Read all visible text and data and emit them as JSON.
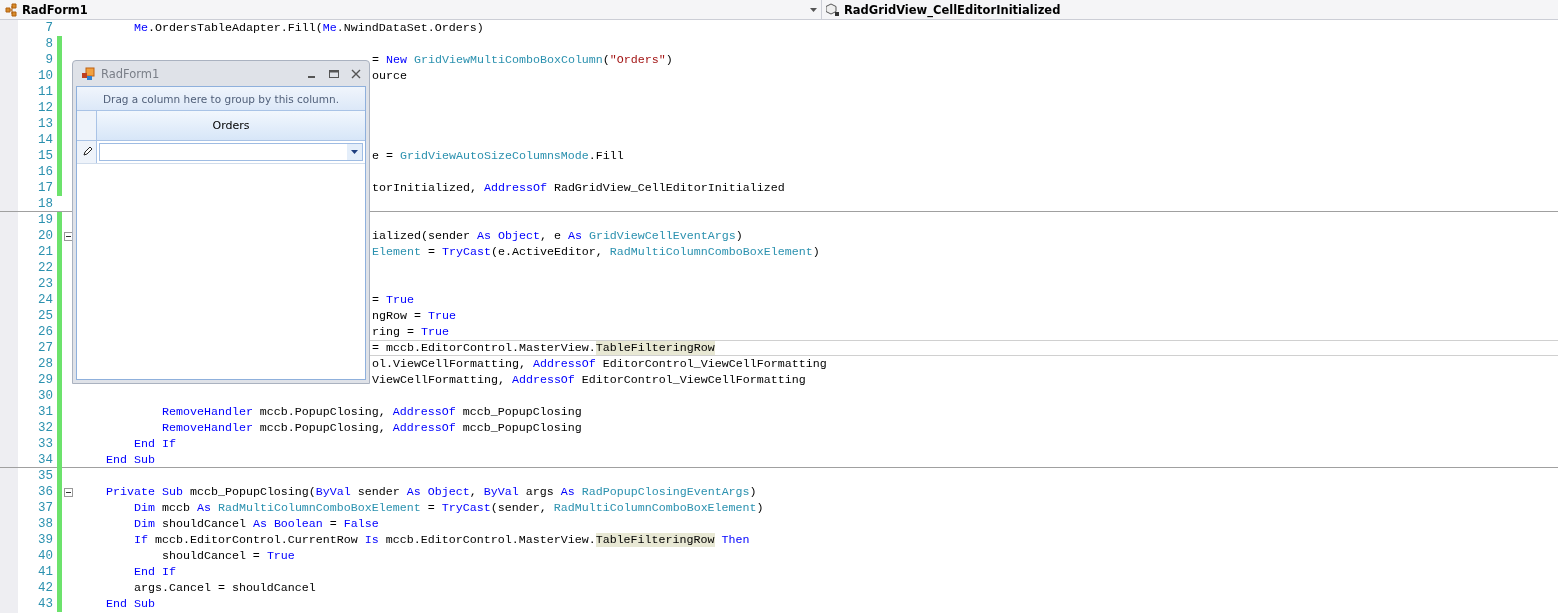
{
  "editor_bar": {
    "class_dropdown": "RadForm1",
    "method_dropdown": "RadGridView_CellEditorInitialized"
  },
  "code_lines": [
    {
      "number": "7",
      "changed": false,
      "collapsible": false,
      "covered": false,
      "current": false,
      "separator": false,
      "tokens": [
        {
          "text": "        Me",
          "kind": "keyword"
        },
        {
          "text": ".OrdersTableAdapter.Fill(",
          "kind": "plain"
        },
        {
          "text": "Me",
          "kind": "keyword"
        },
        {
          "text": ".NwindDataSet.Orders)",
          "kind": "plain"
        }
      ]
    },
    {
      "number": "8",
      "changed": true,
      "collapsible": false,
      "current": false,
      "separator": false
    },
    {
      "number": "9",
      "changed": true,
      "collapsible": false,
      "covered": true,
      "current": false,
      "separator": false,
      "tokens": [
        {
          "text": "= ",
          "kind": "plain"
        },
        {
          "text": "New",
          "kind": "keyword"
        },
        {
          "text": " GridViewMultiComboBoxColumn",
          "kind": "type"
        },
        {
          "text": "(",
          "kind": "plain"
        },
        {
          "text": "\"Orders\"",
          "kind": "string"
        },
        {
          "text": ")",
          "kind": "plain"
        }
      ]
    },
    {
      "number": "10",
      "changed": true,
      "collapsible": false,
      "covered": true,
      "current": false,
      "separator": false,
      "tokens": [
        {
          "text": "ource",
          "kind": "plain"
        }
      ]
    },
    {
      "number": "11",
      "changed": true,
      "collapsible": false,
      "current": false,
      "separator": false
    },
    {
      "number": "12",
      "changed": true,
      "collapsible": false,
      "current": false,
      "separator": false
    },
    {
      "number": "13",
      "changed": true,
      "collapsible": false,
      "current": false,
      "separator": false
    },
    {
      "number": "14",
      "changed": true,
      "collapsible": false,
      "current": false,
      "separator": false
    },
    {
      "number": "15",
      "changed": true,
      "collapsible": false,
      "covered": true,
      "current": false,
      "separator": false,
      "tokens": [
        {
          "text": "e = ",
          "kind": "plain"
        },
        {
          "text": "GridViewAutoSizeColumnsMode",
          "kind": "type"
        },
        {
          "text": ".Fill",
          "kind": "plain"
        }
      ]
    },
    {
      "number": "16",
      "changed": true,
      "collapsible": false,
      "current": false,
      "separator": false
    },
    {
      "number": "17",
      "changed": true,
      "collapsible": false,
      "covered": true,
      "current": false,
      "separator": false,
      "tokens": [
        {
          "text": "torInitialized, ",
          "kind": "plain"
        },
        {
          "text": "AddressOf",
          "kind": "keyword"
        },
        {
          "text": " RadGridView_CellEditorInitialized",
          "kind": "plain"
        }
      ]
    },
    {
      "number": "18",
      "changed": false,
      "collapsible": false,
      "current": false,
      "separator": true
    },
    {
      "number": "19",
      "changed": true,
      "collapsible": false,
      "current": false,
      "separator": false
    },
    {
      "number": "20",
      "changed": true,
      "collapsible": true,
      "covered": true,
      "current": false,
      "separator": false,
      "tokens": [
        {
          "text": "ialized(sender ",
          "kind": "plain"
        },
        {
          "text": "As",
          "kind": "keyword"
        },
        {
          "text": " Object",
          "kind": "keyword"
        },
        {
          "text": ", e ",
          "kind": "plain"
        },
        {
          "text": "As",
          "kind": "keyword"
        },
        {
          "text": " GridViewCellEventArgs",
          "kind": "type"
        },
        {
          "text": ")",
          "kind": "plain"
        }
      ]
    },
    {
      "number": "21",
      "changed": true,
      "collapsible": false,
      "covered": true,
      "current": false,
      "separator": false,
      "tokens": [
        {
          "text": "Element",
          "kind": "type"
        },
        {
          "text": " = ",
          "kind": "plain"
        },
        {
          "text": "TryCast",
          "kind": "keyword"
        },
        {
          "text": "(e.ActiveEditor, ",
          "kind": "plain"
        },
        {
          "text": "RadMultiColumnComboBoxElement",
          "kind": "type"
        },
        {
          "text": ")",
          "kind": "plain"
        }
      ]
    },
    {
      "number": "22",
      "changed": true,
      "collapsible": false,
      "current": false,
      "separator": false
    },
    {
      "number": "23",
      "changed": true,
      "collapsible": false,
      "current": false,
      "separator": false
    },
    {
      "number": "24",
      "changed": true,
      "collapsible": false,
      "covered": true,
      "current": false,
      "separator": false,
      "tokens": [
        {
          "text": "= ",
          "kind": "plain"
        },
        {
          "text": "True",
          "kind": "keyword"
        }
      ]
    },
    {
      "number": "25",
      "changed": true,
      "collapsible": false,
      "covered": true,
      "current": false,
      "separator": false,
      "tokens": [
        {
          "text": "ngRow = ",
          "kind": "plain"
        },
        {
          "text": "True",
          "kind": "keyword"
        }
      ]
    },
    {
      "number": "26",
      "changed": true,
      "collapsible": false,
      "covered": true,
      "current": false,
      "separator": false,
      "tokens": [
        {
          "text": "ring = ",
          "kind": "plain"
        },
        {
          "text": "True",
          "kind": "keyword"
        }
      ]
    },
    {
      "number": "27",
      "changed": true,
      "collapsible": false,
      "covered": true,
      "current": true,
      "separator": false,
      "tokens": [
        {
          "text": "= mccb.EditorControl.MasterView.",
          "kind": "plain"
        },
        {
          "text": "TableFilteringRow",
          "kind": "highlight"
        }
      ]
    },
    {
      "number": "28",
      "changed": true,
      "collapsible": false,
      "covered": true,
      "current": false,
      "separator": false,
      "tokens": [
        {
          "text": "ol.ViewCellFormatting, ",
          "kind": "plain"
        },
        {
          "text": "AddressOf",
          "kind": "keyword"
        },
        {
          "text": " EditorControl_ViewCellFormatting",
          "kind": "plain"
        }
      ]
    },
    {
      "number": "29",
      "changed": true,
      "collapsible": false,
      "covered": true,
      "current": false,
      "separator": false,
      "tokens": [
        {
          "text": "ViewCellFormatting, ",
          "kind": "plain"
        },
        {
          "text": "AddressOf",
          "kind": "keyword"
        },
        {
          "text": " EditorControl_ViewCellFormatting",
          "kind": "plain"
        }
      ]
    },
    {
      "number": "30",
      "changed": true,
      "collapsible": false,
      "current": false,
      "separator": false
    },
    {
      "number": "31",
      "changed": true,
      "collapsible": false,
      "covered": false,
      "current": false,
      "separator": false,
      "tokens": [
        {
          "text": "            RemoveHandler",
          "kind": "keyword"
        },
        {
          "text": " mccb.PopupClosing, ",
          "kind": "plain"
        },
        {
          "text": "AddressOf",
          "kind": "keyword"
        },
        {
          "text": " mccb_PopupClosing",
          "kind": "plain"
        }
      ]
    },
    {
      "number": "32",
      "changed": true,
      "collapsible": false,
      "covered": false,
      "current": false,
      "separator": false,
      "tokens": [
        {
          "text": "            RemoveHandler",
          "kind": "keyword"
        },
        {
          "text": " mccb.PopupClosing, ",
          "kind": "plain"
        },
        {
          "text": "AddressOf",
          "kind": "keyword"
        },
        {
          "text": " mccb_PopupClosing",
          "kind": "plain"
        }
      ]
    },
    {
      "number": "33",
      "changed": true,
      "collapsible": false,
      "covered": false,
      "current": false,
      "separator": false,
      "tokens": [
        {
          "text": "        End If",
          "kind": "keyword"
        }
      ]
    },
    {
      "number": "34",
      "changed": true,
      "collapsible": false,
      "covered": false,
      "current": false,
      "separator": true,
      "tokens": [
        {
          "text": "    End Sub",
          "kind": "keyword"
        }
      ]
    },
    {
      "number": "35",
      "changed": true,
      "collapsible": false,
      "current": false,
      "separator": false
    },
    {
      "number": "36",
      "changed": true,
      "collapsible": true,
      "covered": false,
      "current": false,
      "separator": false,
      "tokens": [
        {
          "text": "    Private Sub",
          "kind": "keyword"
        },
        {
          "text": " mccb_PopupClosing(",
          "kind": "plain"
        },
        {
          "text": "ByVal",
          "kind": "keyword"
        },
        {
          "text": " sender ",
          "kind": "plain"
        },
        {
          "text": "As Object",
          "kind": "keyword"
        },
        {
          "text": ", ",
          "kind": "plain"
        },
        {
          "text": "ByVal",
          "kind": "keyword"
        },
        {
          "text": " args ",
          "kind": "plain"
        },
        {
          "text": "As",
          "kind": "keyword"
        },
        {
          "text": " RadPopupClosingEventArgs",
          "kind": "type"
        },
        {
          "text": ")",
          "kind": "plain"
        }
      ]
    },
    {
      "number": "37",
      "changed": true,
      "collapsible": false,
      "covered": false,
      "current": false,
      "separator": false,
      "tokens": [
        {
          "text": "        Dim",
          "kind": "keyword"
        },
        {
          "text": " mccb ",
          "kind": "plain"
        },
        {
          "text": "As",
          "kind": "keyword"
        },
        {
          "text": " RadMultiColumnComboBoxElement",
          "kind": "type"
        },
        {
          "text": " = ",
          "kind": "plain"
        },
        {
          "text": "TryCast",
          "kind": "keyword"
        },
        {
          "text": "(sender, ",
          "kind": "plain"
        },
        {
          "text": "RadMultiColumnComboBoxElement",
          "kind": "type"
        },
        {
          "text": ")",
          "kind": "plain"
        }
      ]
    },
    {
      "number": "38",
      "changed": true,
      "collapsible": false,
      "covered": false,
      "current": false,
      "separator": false,
      "tokens": [
        {
          "text": "        Dim",
          "kind": "keyword"
        },
        {
          "text": " shouldCancel ",
          "kind": "plain"
        },
        {
          "text": "As Boolean",
          "kind": "keyword"
        },
        {
          "text": " = ",
          "kind": "plain"
        },
        {
          "text": "False",
          "kind": "keyword"
        }
      ]
    },
    {
      "number": "39",
      "changed": true,
      "collapsible": false,
      "covered": false,
      "current": false,
      "separator": false,
      "tokens": [
        {
          "text": "        If",
          "kind": "keyword"
        },
        {
          "text": " mccb.EditorControl.CurrentRow ",
          "kind": "plain"
        },
        {
          "text": "Is",
          "kind": "keyword"
        },
        {
          "text": " mccb.EditorControl.MasterView.",
          "kind": "plain"
        },
        {
          "text": "TableFilteringRow",
          "kind": "highlight"
        },
        {
          "text": " Then",
          "kind": "keyword"
        }
      ]
    },
    {
      "number": "40",
      "changed": true,
      "collapsible": false,
      "covered": false,
      "current": false,
      "separator": false,
      "tokens": [
        {
          "text": "            shouldCancel = ",
          "kind": "plain"
        },
        {
          "text": "True",
          "kind": "keyword"
        }
      ]
    },
    {
      "number": "41",
      "changed": true,
      "collapsible": false,
      "covered": false,
      "current": false,
      "separator": false,
      "tokens": [
        {
          "text": "        End If",
          "kind": "keyword"
        }
      ]
    },
    {
      "number": "42",
      "changed": true,
      "collapsible": false,
      "covered": false,
      "current": false,
      "separator": false,
      "tokens": [
        {
          "text": "        args.Cancel = shouldCancel",
          "kind": "plain"
        }
      ]
    },
    {
      "number": "43",
      "changed": true,
      "collapsible": false,
      "covered": false,
      "current": false,
      "separator": false,
      "tokens": [
        {
          "text": "    End Sub",
          "kind": "keyword"
        }
      ]
    }
  ],
  "form_window": {
    "title": "RadForm1",
    "group_panel": "Drag a column here to group by this column.",
    "columns": [
      "Orders"
    ],
    "edit_row": {
      "editing": true
    }
  }
}
